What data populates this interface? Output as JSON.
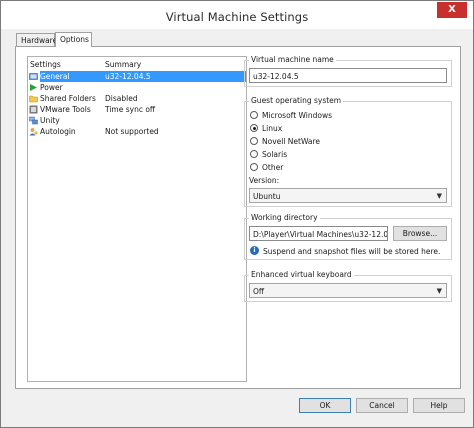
{
  "window": {
    "title": "Virtual Machine Settings",
    "close_symbol": "X"
  },
  "tabs": [
    {
      "label": "Hardware"
    },
    {
      "label": "Options"
    }
  ],
  "settings": {
    "col_settings": "Settings",
    "col_summary": "Summary",
    "items": [
      {
        "name": "General",
        "summary": "u32-12.04.5",
        "icon": "general-icon",
        "selected": true
      },
      {
        "name": "Power",
        "summary": "",
        "icon": "power-icon"
      },
      {
        "name": "Shared Folders",
        "summary": "Disabled",
        "icon": "shared-folders-icon"
      },
      {
        "name": "VMware Tools",
        "summary": "Time sync off",
        "icon": "vmware-tools-icon"
      },
      {
        "name": "Unity",
        "summary": "",
        "icon": "unity-icon"
      },
      {
        "name": "Autologin",
        "summary": "Not supported",
        "icon": "autologin-icon"
      }
    ]
  },
  "vm_name": {
    "title": "Virtual machine name",
    "value": "u32-12.04.5"
  },
  "guest_os": {
    "title": "Guest operating system",
    "options": [
      "Microsoft Windows",
      "Linux",
      "Novell NetWare",
      "Solaris",
      "Other"
    ],
    "selected": "Linux",
    "version_label": "Version:",
    "version_value": "Ubuntu"
  },
  "working_dir": {
    "title": "Working directory",
    "value": "D:\\Player\\Virtual Machines\\u32-12.04.5",
    "browse_label": "Browse...",
    "info_text": "Suspend and snapshot files will be stored here."
  },
  "keyboard": {
    "title": "Enhanced virtual keyboard",
    "value": "Off"
  },
  "buttons": {
    "ok": "OK",
    "cancel": "Cancel",
    "help": "Help"
  },
  "colors": {
    "selection": "#3399ff",
    "close": "#c7302c"
  }
}
